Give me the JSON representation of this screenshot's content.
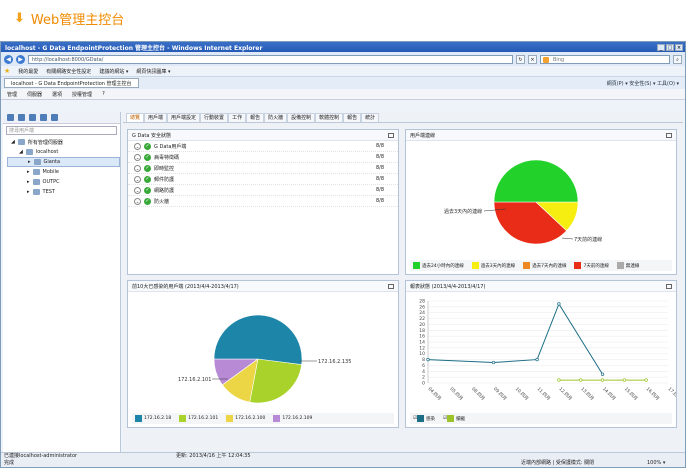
{
  "heading": "Web管理主控台",
  "browser": {
    "title": "localhost - G Data EndpointProtection 管理主控台 - Windows Internet Explorer",
    "address": "http://localhost:8000/GData/",
    "search_placeholder": "Bing",
    "fav_label": "我的最愛",
    "fav_items": [
      "有關網路安全性設定",
      "建議的網站 ▾",
      "網頁快訊圖庫 ▾"
    ],
    "tab_label": "localhost - G Data EndpointProtection 管理主控台",
    "tab_tools": "網頁(P) ▾  安全性(S) ▾  工具(O) ▾"
  },
  "menu": [
    "管理",
    "伺服器",
    "選項",
    "授權管理",
    "?"
  ],
  "sidebar": {
    "search_placeholder": "搜尋用戶端",
    "tree": [
      {
        "label": "所有管理伺服器",
        "level": 0
      },
      {
        "label": "localhost",
        "level": 1
      },
      {
        "label": "Gianta",
        "level": 2,
        "selected": true
      },
      {
        "label": "Mobile",
        "level": 2
      },
      {
        "label": "OUTPC",
        "level": 2
      },
      {
        "label": "TEST",
        "level": 2
      }
    ]
  },
  "tabs": [
    "總覽",
    "用戶端",
    "用戶端設定",
    "行動裝置",
    "工作",
    "報告",
    "防火牆",
    "設備控制",
    "軟體控制",
    "報告",
    "統計"
  ],
  "status_panel": {
    "title": "G Data 安全狀態",
    "rows": [
      {
        "label": "G Data用戶端",
        "value": "8/8"
      },
      {
        "label": "病毒特徵碼",
        "value": "8/8"
      },
      {
        "label": "即時監控",
        "value": "8/8"
      },
      {
        "label": "郵件防護",
        "value": "8/8"
      },
      {
        "label": "網路防護",
        "value": "8/8"
      },
      {
        "label": "防火牆",
        "value": "8/8"
      }
    ]
  },
  "connection_panel": {
    "title": "用戶端連線",
    "label_left": "過去3天內的連線",
    "label_right": "7天前的連線",
    "legend": [
      "過去24小時內的連線",
      "過去3天內的連線",
      "過去7天內的連線",
      "7天前的連線",
      "無連線"
    ]
  },
  "infection_panel": {
    "title": "前10大已感染的用戶端 (2013/4/4-2013/4/17)",
    "labels": [
      "172.16.2.101",
      "172.16.2.135"
    ],
    "legend": [
      "172.16.2.18",
      "172.16.2.101",
      "172.16.2.100",
      "172.16.2.109"
    ]
  },
  "report_panel": {
    "title": "報表狀態 (2013/4/4-2013/4/17)",
    "legend": [
      "感染",
      "攔截"
    ]
  },
  "chart_data": [
    {
      "type": "pie",
      "title": "用戶端連線",
      "labels": [
        "過去24小時內的連線",
        "過去3天內的連線",
        "過去7天內的連線",
        "7天前的連線",
        "無連線"
      ],
      "values": [
        50,
        12,
        0,
        38,
        0
      ],
      "colors": [
        "#22d22b",
        "#f5ee10",
        "#ee8820",
        "#e82c17",
        "#aaaaaa"
      ]
    },
    {
      "type": "pie",
      "title": "前10大已感染的用戶端",
      "labels": [
        "172.16.2.18",
        "172.16.2.101",
        "172.16.2.100",
        "172.16.2.109"
      ],
      "values": [
        52,
        26,
        12,
        10
      ],
      "colors": [
        "#1d86a8",
        "#a9d22a",
        "#ecd646",
        "#b88ad6"
      ]
    },
    {
      "type": "line",
      "title": "報表狀態",
      "x": [
        "04.四月",
        "05.四月",
        "08.四月",
        "09.四月",
        "10.四月",
        "11.四月",
        "12.四月",
        "13.四月",
        "14.四月",
        "15.四月",
        "16.四月",
        "17.四月"
      ],
      "ylim": [
        0,
        28
      ],
      "yticks": [
        0,
        2,
        4,
        6,
        8,
        10,
        12,
        14,
        16,
        18,
        20,
        22,
        24,
        26,
        28
      ],
      "series": [
        {
          "name": "感染",
          "color": "#1c6d86",
          "values": [
            8,
            null,
            null,
            7,
            null,
            8,
            27,
            null,
            3,
            null,
            null,
            null
          ]
        },
        {
          "name": "攔截",
          "color": "#9cc32a",
          "values": [
            null,
            null,
            null,
            null,
            null,
            null,
            1,
            1,
            1,
            1,
            1,
            null
          ]
        }
      ]
    }
  ],
  "status": {
    "left": "已連接localhost-administrator",
    "update": "更新: 2013/4/16 上午 12:04:35",
    "done": "完成",
    "zone": "近端內部網路 | 受保護模式: 關閉",
    "zoom": "100% ▾"
  }
}
